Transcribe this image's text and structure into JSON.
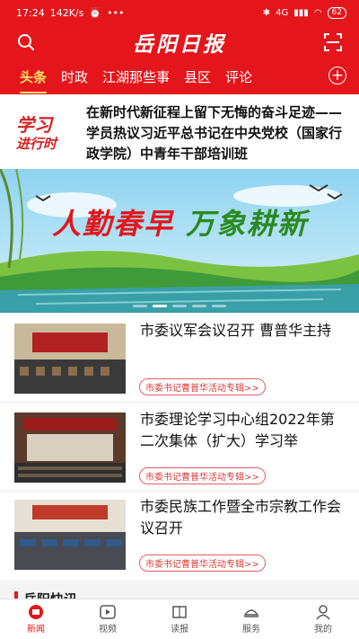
{
  "status": {
    "time": "17:24",
    "network_speed": "142K/s",
    "more": "•••",
    "signal": "4G",
    "battery": "62"
  },
  "header": {
    "logo": "岳阳日报",
    "tabs": [
      {
        "label": "头条",
        "active": true
      },
      {
        "label": "时政",
        "active": false
      },
      {
        "label": "江湖那些事",
        "active": false
      },
      {
        "label": "县区",
        "active": false
      },
      {
        "label": "评论",
        "active": false
      }
    ],
    "add_tab": "+"
  },
  "feature": {
    "logo_line1": "学习",
    "logo_line2": "进行时",
    "text": "在新时代新征程上留下无悔的奋斗足迹——学员热议习近平总书记在中央党校（国家行政学院）中青年干部培训班"
  },
  "carousel": {
    "title_a": "人勤春早",
    "title_b": "万象耕新",
    "dots": 5,
    "active_dot": 2
  },
  "news": [
    {
      "title": "市委议军会议召开 曹普华主持",
      "tag": "市委书记曹普华活动专辑>>"
    },
    {
      "title": "市委理论学习中心组2022年第二次集体（扩大）学习举",
      "tag": "市委书记曹普华活动专辑>>"
    },
    {
      "title": "市委民族工作暨全市宗教工作会议召开",
      "tag": "市委书记曹普华活动专辑>>"
    }
  ],
  "section": {
    "title": "岳阳快讯"
  },
  "bottom_nav": [
    {
      "label": "新闻",
      "icon": "home-icon",
      "active": true
    },
    {
      "label": "视频",
      "icon": "video-icon",
      "active": false
    },
    {
      "label": "读报",
      "icon": "newspaper-icon",
      "active": false
    },
    {
      "label": "服务",
      "icon": "service-icon",
      "active": false
    },
    {
      "label": "我的",
      "icon": "user-icon",
      "active": false
    }
  ],
  "colors": {
    "brand_red": "#e4161b",
    "tab_active": "#ffe36a"
  }
}
